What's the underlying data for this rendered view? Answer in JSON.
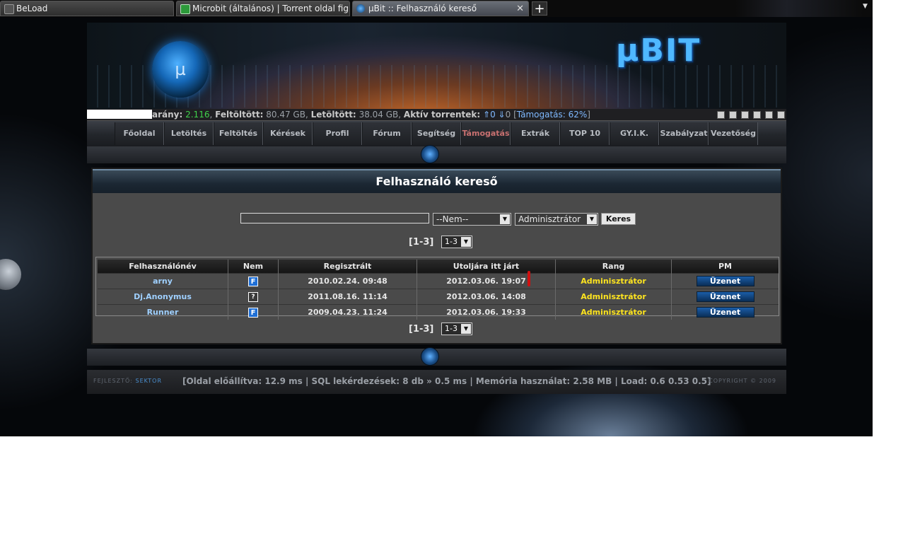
{
  "browser": {
    "tabs": [
      {
        "title": "BeLoad"
      },
      {
        "title": "Microbit (általános) | Torrent oldal fig..."
      },
      {
        "title": "µBit :: Felhasználó kereső"
      }
    ],
    "new_tab": "+",
    "menu_arrow": "▼"
  },
  "header": {
    "logo_text": "µBIT",
    "orb_text": "µ"
  },
  "stats": {
    "ratio_label": "arány:",
    "ratio_value": "2.116",
    "uploaded_label": "Feltöltött:",
    "uploaded_value": "80.47 GB",
    "downloaded_label": "Letöltött:",
    "downloaded_value": "38.04 GB",
    "active_label": "Aktív torrentek:",
    "active_up": "0",
    "active_down": "0",
    "support": "Támogatás: 62%"
  },
  "nav": {
    "items": [
      {
        "label": "Főoldal"
      },
      {
        "label": "Letöltés"
      },
      {
        "label": "Feltöltés"
      },
      {
        "label": "Kérések"
      },
      {
        "label": "Profil"
      },
      {
        "label": "Fórum"
      },
      {
        "label": "Segítség"
      },
      {
        "label": "Támogatás"
      },
      {
        "label": "Extrák"
      },
      {
        "label": "TOP 10"
      },
      {
        "label": "GY.I.K."
      },
      {
        "label": "Szabályzat"
      },
      {
        "label": "Vezetőség"
      }
    ]
  },
  "page": {
    "title": "Felhasználó kereső",
    "search_value": "",
    "gender_select": "--Nem--",
    "rank_select": "Adminisztrátor",
    "search_button": "Keres",
    "pager_label": "[1-3]",
    "pager_select": "1-3"
  },
  "table": {
    "headers": [
      "Felhasználónév",
      "Nem",
      "Regisztrált",
      "Utoljára itt járt",
      "Rang",
      "PM"
    ],
    "rows": [
      {
        "user": "arny",
        "sex": "F",
        "registered": "2010.02.24. 09:48",
        "last_seen": "2012.03.06. 19:07",
        "rank": "Adminisztrátor",
        "pm": "Üzenet"
      },
      {
        "user": "Dj.Anonymus",
        "sex": "?",
        "registered": "2011.08.16. 11:14",
        "last_seen": "2012.03.06. 14:08",
        "rank": "Adminisztrátor",
        "pm": "Üzenet"
      },
      {
        "user": "Runner",
        "sex": "F",
        "registered": "2009.04.23. 11:24",
        "last_seen": "2012.03.06. 19:33",
        "rank": "Adminisztrátor",
        "pm": "Üzenet"
      }
    ]
  },
  "footer": {
    "dev_label": "FEJLESZTŐ:",
    "dev_name": "SEKTOR",
    "stats": "[Oldal előállítva: 12.9 ms | SQL lekérdezések: 8 db » 0.5 ms | Memória használat: 2.58 MB | Load: 0.6 0.53 0.5]",
    "copyright": "COPYRIGHT © 2009"
  },
  "colors": {
    "ratio_green": "#3fd14a",
    "rank_yellow": "#ffe51f",
    "username_blue": "#9fd0ff",
    "active_nav": "#c87070"
  }
}
